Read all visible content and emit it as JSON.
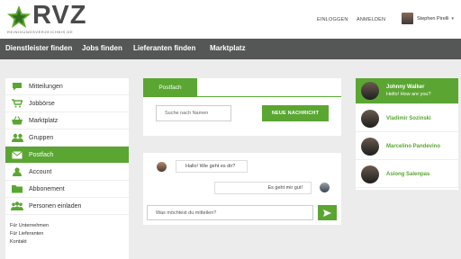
{
  "header": {
    "logo_text": "RVZ",
    "logo_subtitle": "REINIGUNGSVERZEICHNIS.DE",
    "login_link": "EINLOGGEN",
    "register_link": "ANMELDEN",
    "user_name": "Stephen Pirelli"
  },
  "nav": {
    "items": [
      "Dienstleister finden",
      "Jobs finden",
      "Lieferanten finden",
      "Marktplatz"
    ]
  },
  "sidebar": {
    "items": [
      {
        "label": "Mitteilungen",
        "icon": "chat-icon"
      },
      {
        "label": "Jobbörse",
        "icon": "cart-icon"
      },
      {
        "label": "Marktplatz",
        "icon": "basket-icon"
      },
      {
        "label": "Gruppen",
        "icon": "group-icon"
      },
      {
        "label": "Postfach",
        "icon": "mail-icon"
      },
      {
        "label": "Account",
        "icon": "user-icon"
      },
      {
        "label": "Abbonement",
        "icon": "folder-icon"
      },
      {
        "label": "Personen einladen",
        "icon": "people-icon"
      }
    ],
    "active_index": 4,
    "footer_links": [
      "Für Unternehmen",
      "Für Lieferanten",
      "Kontakt"
    ]
  },
  "postfach": {
    "tab_label": "Postfach",
    "search_placeholder": "Suche nach Namen",
    "new_message_button": "NEUE NACHRICHT"
  },
  "chat": {
    "messages": [
      {
        "text": "Hallo! Wie geht es dir?",
        "side": "left"
      },
      {
        "text": "Es geht mir gut!",
        "side": "right"
      }
    ],
    "input_placeholder": "Was möchtest du mitteilen?"
  },
  "contacts": {
    "items": [
      {
        "name": "Johnny Walker",
        "message": "Hello! How are you?"
      },
      {
        "name": "Vladimir Sozinski",
        "message": ""
      },
      {
        "name": "Marcelino Pandevino",
        "message": ""
      },
      {
        "name": "Asiong Salenpas",
        "message": ""
      }
    ],
    "active_index": 0
  },
  "colors": {
    "accent": "#5ba632",
    "nav_bg": "#555757",
    "page_bg": "#ececec"
  }
}
